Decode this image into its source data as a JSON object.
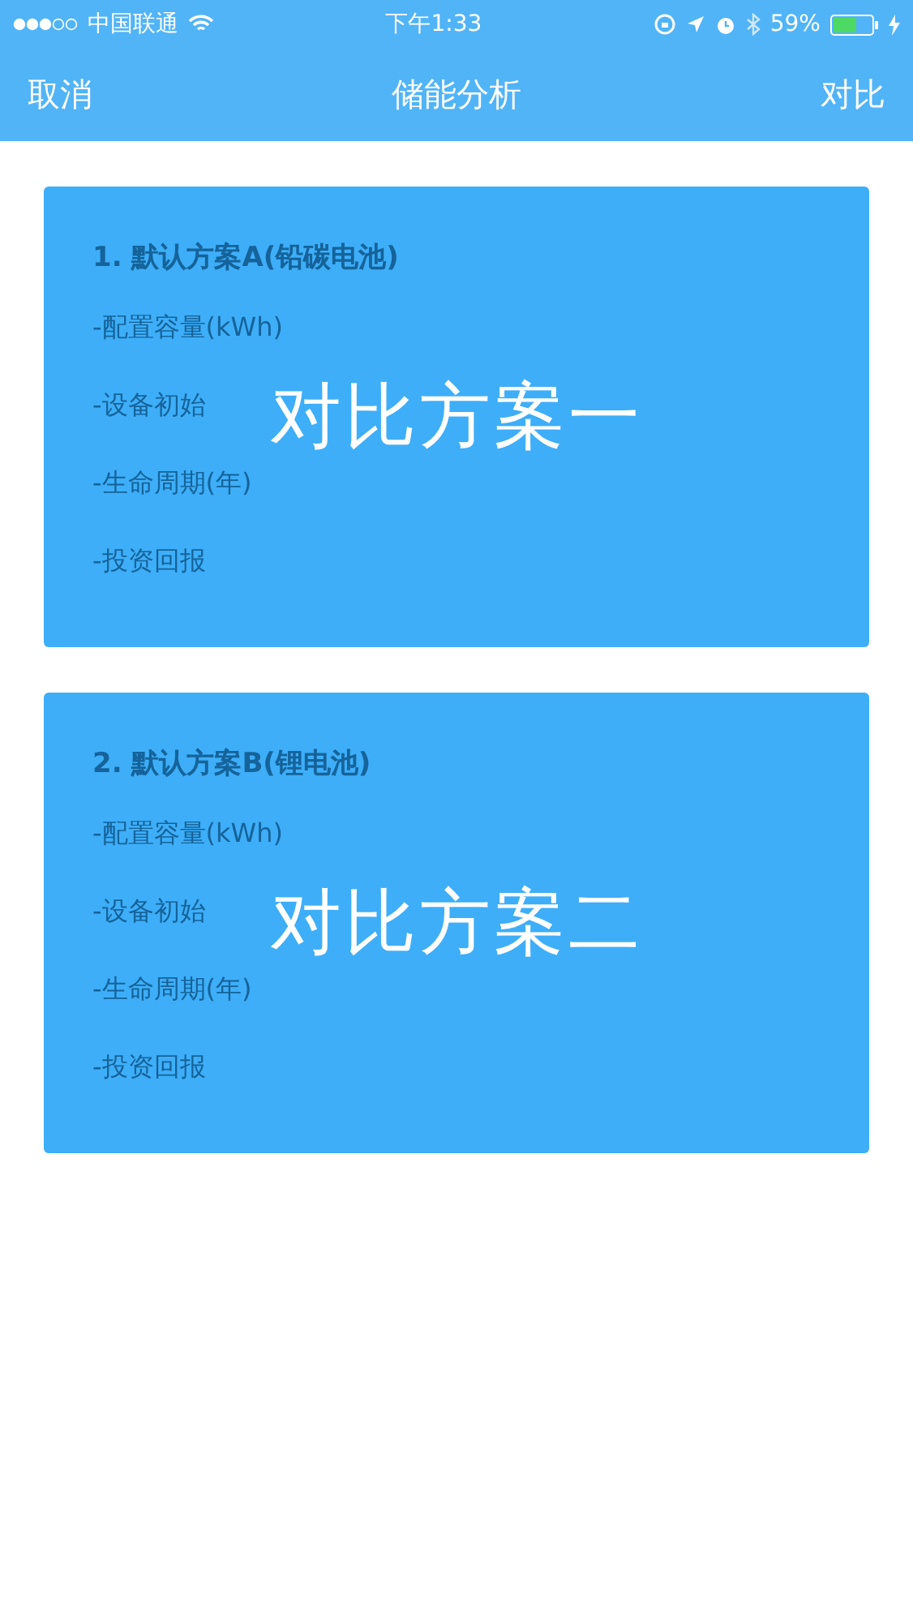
{
  "status_bar": {
    "carrier": "中国联通",
    "time": "下午1:33",
    "battery": "59%"
  },
  "nav_bar": {
    "left": "取消",
    "title": "储能分析",
    "right": "对比"
  },
  "plans": [
    {
      "title": "1. 默认方案A(铅碳电池)",
      "rows": [
        "-配置容量(kWh)",
        "-设备初始",
        "-生命周期(年)",
        "-投资回报"
      ],
      "overlay": "对比方案一"
    },
    {
      "title": "2. 默认方案B(锂电池)",
      "rows": [
        "-配置容量(kWh)",
        "-设备初始",
        "-生命周期(年)",
        "-投资回报"
      ],
      "overlay": "对比方案二"
    }
  ]
}
